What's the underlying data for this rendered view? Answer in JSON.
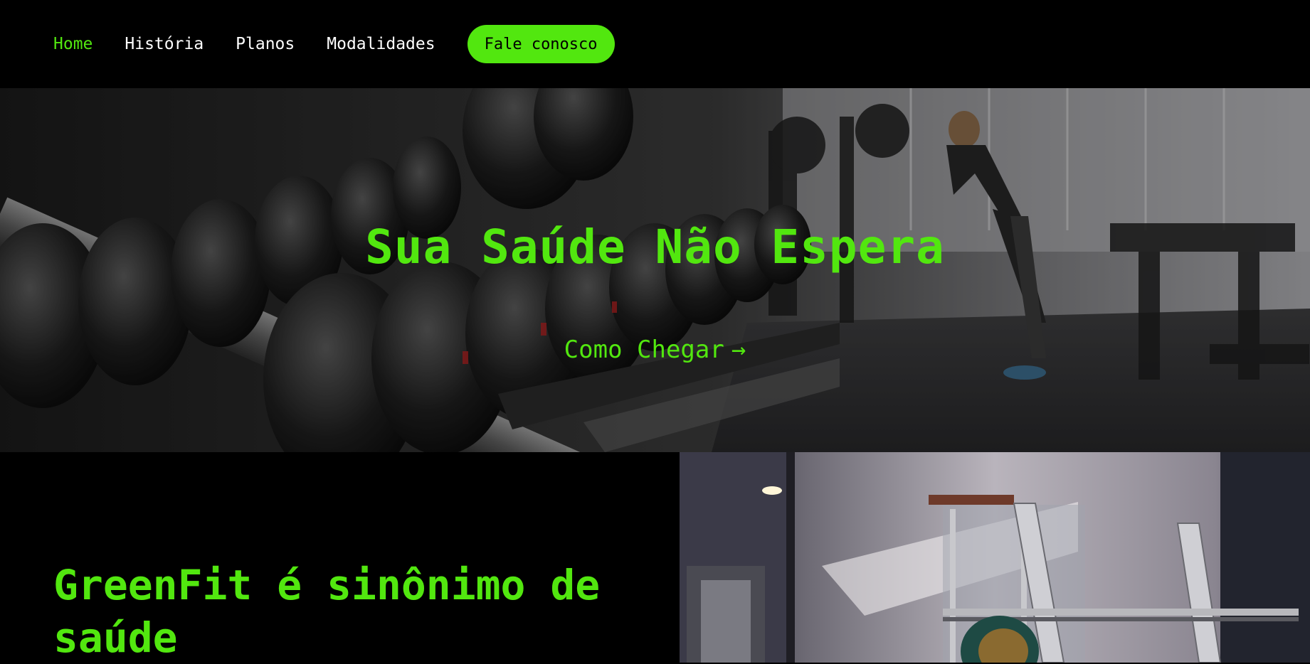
{
  "nav": {
    "items": [
      {
        "label": "Home",
        "active": true
      },
      {
        "label": "História",
        "active": false
      },
      {
        "label": "Planos",
        "active": false
      },
      {
        "label": "Modalidades",
        "active": false
      }
    ],
    "cta_label": "Fale conosco"
  },
  "hero": {
    "title": "Sua Saúde Não Espera",
    "link_label": "Como Chegar",
    "link_icon": "arrow-right-icon",
    "image": "gym-dumbbell-rack-photo"
  },
  "about": {
    "title": "GreenFit é sinônimo de saúde",
    "image": "gym-squat-rack-photo"
  },
  "colors": {
    "accent": "#52e70f",
    "background": "#000000",
    "nav_text": "#ffffff"
  }
}
